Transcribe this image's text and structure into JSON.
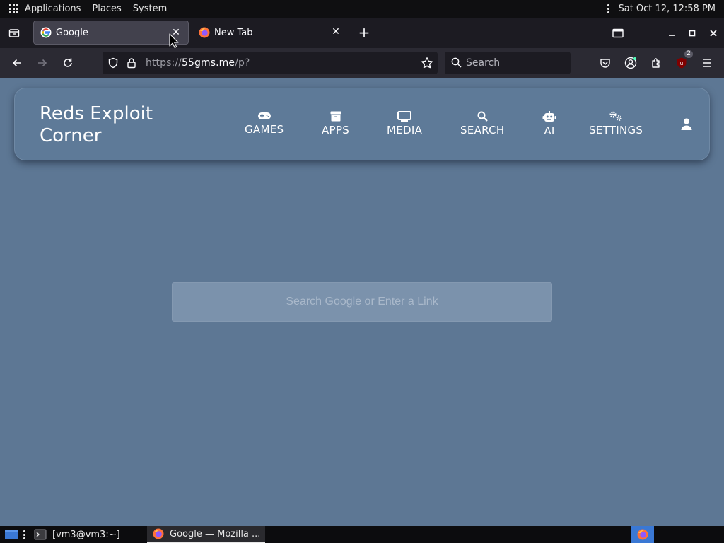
{
  "system_panel": {
    "menus": [
      "Applications",
      "Places",
      "System"
    ],
    "clock": "Sat Oct 12, 12:58 PM"
  },
  "browser": {
    "tabs": [
      {
        "title": "Google",
        "active": true
      },
      {
        "title": "New Tab",
        "active": false
      }
    ],
    "url_host": "https://55gms.me",
    "url_path": "/p?",
    "search_placeholder": "Search",
    "extension_badge": "2"
  },
  "site": {
    "brand": "Reds Exploit Corner",
    "nav": [
      {
        "label": "GAMES",
        "icon": "gamepad-icon"
      },
      {
        "label": "APPS",
        "icon": "archive-icon"
      },
      {
        "label": "MEDIA",
        "icon": "monitor-icon"
      },
      {
        "label": "SEARCH",
        "icon": "magnifier-icon"
      },
      {
        "label": "AI",
        "icon": "robot-icon"
      },
      {
        "label": "SETTINGS",
        "icon": "gears-icon"
      }
    ],
    "search_placeholder": "Search Google or Enter a Link"
  },
  "taskbar": {
    "items": [
      "[vm3@vm3:~]",
      "Google — Mozilla ..."
    ]
  },
  "colors": {
    "page_bg": "#5d7794",
    "nav_bg": "#5e7a98",
    "browser_chrome": "#2b2a33",
    "tabstrip": "#1c1b22"
  }
}
